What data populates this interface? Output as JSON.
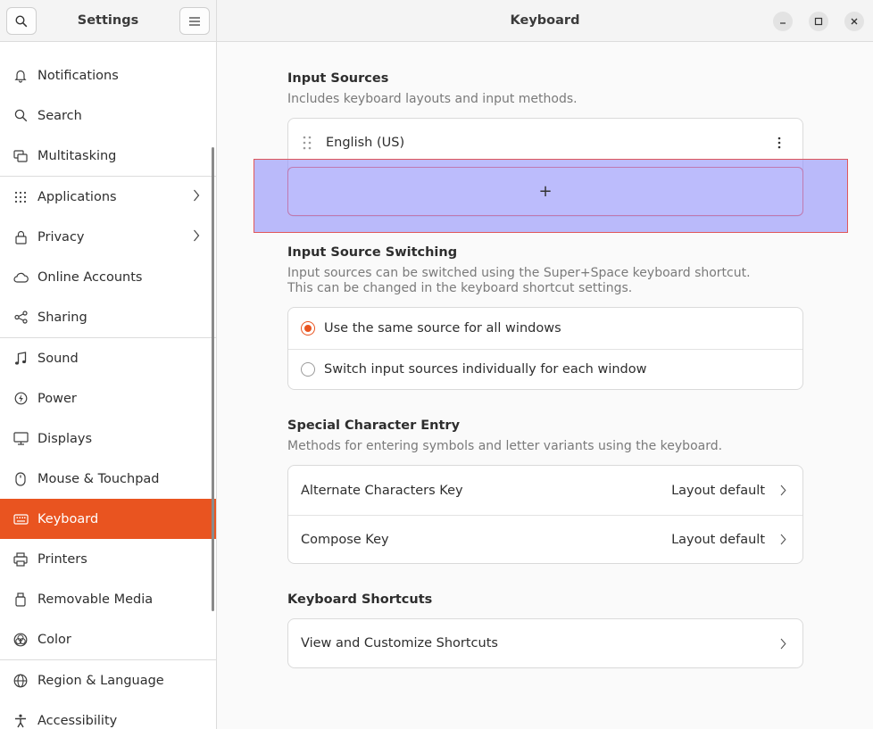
{
  "sidebar": {
    "title": "Settings",
    "items": [
      {
        "label": "Notifications",
        "icon": "bell-icon"
      },
      {
        "label": "Search",
        "icon": "search-icon"
      },
      {
        "label": "Multitasking",
        "icon": "multitasking-icon"
      },
      {
        "label": "Applications",
        "icon": "apps-grid-icon",
        "chevron": true
      },
      {
        "label": "Privacy",
        "icon": "lock-icon",
        "chevron": true
      },
      {
        "label": "Online Accounts",
        "icon": "cloud-icon"
      },
      {
        "label": "Sharing",
        "icon": "share-icon"
      },
      {
        "label": "Sound",
        "icon": "music-note-icon"
      },
      {
        "label": "Power",
        "icon": "power-icon"
      },
      {
        "label": "Displays",
        "icon": "display-icon"
      },
      {
        "label": "Mouse & Touchpad",
        "icon": "mouse-icon"
      },
      {
        "label": "Keyboard",
        "icon": "keyboard-icon",
        "active": true
      },
      {
        "label": "Printers",
        "icon": "printer-icon"
      },
      {
        "label": "Removable Media",
        "icon": "usb-drive-icon"
      },
      {
        "label": "Color",
        "icon": "color-icon"
      },
      {
        "label": "Region & Language",
        "icon": "globe-icon"
      },
      {
        "label": "Accessibility",
        "icon": "accessibility-icon"
      }
    ]
  },
  "header": {
    "title": "Keyboard"
  },
  "input_sources": {
    "title": "Input Sources",
    "subtitle": "Includes keyboard layouts and input methods.",
    "items": [
      {
        "label": "English (US)"
      }
    ],
    "add_label": "+"
  },
  "switching": {
    "title": "Input Source Switching",
    "subtitle_line1": "Input sources can be switched using the Super+Space keyboard shortcut.",
    "subtitle_line2": "This can be changed in the keyboard shortcut settings.",
    "options": [
      {
        "label": "Use the same source for all windows",
        "selected": true
      },
      {
        "label": "Switch input sources individually for each window",
        "selected": false
      }
    ]
  },
  "special": {
    "title": "Special Character Entry",
    "subtitle": "Methods for entering symbols and letter variants using the keyboard.",
    "rows": [
      {
        "label": "Alternate Characters Key",
        "value": "Layout default"
      },
      {
        "label": "Compose Key",
        "value": "Layout default"
      }
    ]
  },
  "shortcuts": {
    "title": "Keyboard Shortcuts",
    "row_label": "View and Customize Shortcuts"
  },
  "colors": {
    "accent": "#e95420",
    "highlight": "#9898fa"
  }
}
